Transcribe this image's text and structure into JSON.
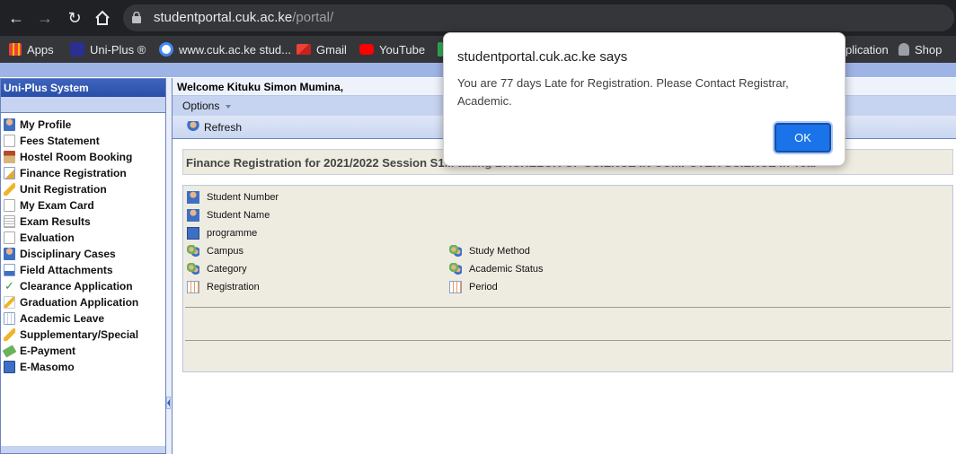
{
  "browser": {
    "url_host": "studentportal.cuk.ac.ke",
    "url_path": "/portal/",
    "bookmarks": [
      {
        "label": "Apps",
        "icon": "apps-grid-icon"
      },
      {
        "label": "Uni-Plus ®",
        "icon": "uniplus-icon"
      },
      {
        "label": "www.cuk.ac.ke stud...",
        "icon": "google-icon"
      },
      {
        "label": "Gmail",
        "icon": "gmail-icon"
      },
      {
        "label": "YouTube",
        "icon": "youtube-icon"
      },
      {
        "label": "plication",
        "icon": "bookmark-icon"
      },
      {
        "label": "Shop",
        "icon": "shop-icon"
      }
    ]
  },
  "sidebar": {
    "title": "Uni-Plus System",
    "items": [
      {
        "label": "My Profile",
        "icon": "user-icon"
      },
      {
        "label": "Fees Statement",
        "icon": "document-icon"
      },
      {
        "label": "Hostel Room Booking",
        "icon": "house-icon"
      },
      {
        "label": "Finance Registration",
        "icon": "edit-icon"
      },
      {
        "label": "Unit Registration",
        "icon": "pencil-icon"
      },
      {
        "label": "My Exam Card",
        "icon": "document-icon"
      },
      {
        "label": "Exam Results",
        "icon": "list-document-icon"
      },
      {
        "label": "Evaluation",
        "icon": "document-icon"
      },
      {
        "label": "Disciplinary Cases",
        "icon": "user-icon"
      },
      {
        "label": "Field Attachments",
        "icon": "user-document-icon"
      },
      {
        "label": "Clearance Application",
        "icon": "check-icon"
      },
      {
        "label": "Graduation Application",
        "icon": "pencil-icon"
      },
      {
        "label": "Academic Leave",
        "icon": "calendar-icon"
      },
      {
        "label": "Supplementary/Special",
        "icon": "pencil-icon"
      },
      {
        "label": "E-Payment",
        "icon": "money-icon"
      },
      {
        "label": "E-Masomo",
        "icon": "book-icon"
      }
    ]
  },
  "main": {
    "welcome": "Welcome Kituku Simon Mumina,",
    "options_label": "Options",
    "refresh_label": "Refresh",
    "registration_title": "Finance Registration for 2021/2022 Session S1",
    "registration_title_rest": "... taking BACHELOR OF SCIENCE IN COMPUTER SCIENCE in Year",
    "fields_left": [
      "Student Number",
      "Student Name",
      "programme",
      "Campus",
      "Category",
      "Registration"
    ],
    "fields_right": [
      "Study Method",
      "Academic Status",
      "Period"
    ]
  },
  "dialog": {
    "title": "studentportal.cuk.ac.ke says",
    "message": "You are 77 days Late for Registration. Please Contact Registrar, Academic.",
    "ok_label": "OK"
  },
  "colors": {
    "chrome_dark": "#202124",
    "sidebar_header": "#2a4fa8",
    "panel_bg": "#eeece1",
    "ok_button": "#1a73e8"
  }
}
